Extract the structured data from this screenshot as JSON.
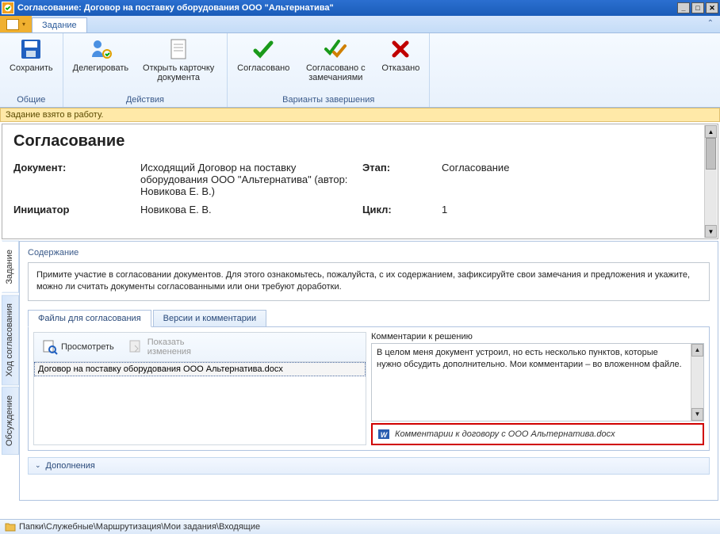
{
  "window": {
    "title": "Согласование: Договор на поставку оборудования ООО \"Альтернатива\""
  },
  "tabs": {
    "main": "Задание"
  },
  "ribbon": {
    "groups": [
      {
        "label": "Общие",
        "buttons": [
          {
            "label": "Сохранить"
          }
        ]
      },
      {
        "label": "Действия",
        "buttons": [
          {
            "label": "Делегировать"
          },
          {
            "label": "Открыть карточку документа"
          }
        ]
      },
      {
        "label": "Варианты завершения",
        "buttons": [
          {
            "label": "Согласовано"
          },
          {
            "label": "Согласовано с замечаниями"
          },
          {
            "label": "Отказано"
          }
        ]
      }
    ]
  },
  "status_message": "Задание взято в работу.",
  "info": {
    "heading": "Согласование",
    "doc_label": "Документ:",
    "doc_value": "Исходящий Договор на поставку оборудования ООО \"Альтернатива\" (автор: Новикова Е. В.)",
    "stage_label": "Этап:",
    "stage_value": "Согласование",
    "initiator_label": "Инициатор",
    "initiator_value": "Новикова Е. В.",
    "cycle_label": "Цикл:",
    "cycle_value": "1"
  },
  "side_tabs": {
    "task": "Задание",
    "progress": "Ход согласования",
    "discussion": "Обсуждение"
  },
  "content": {
    "section_label": "Содержание",
    "instructions": "Примите участие в согласовании документов. Для этого ознакомьтесь, пожалуйста, с их содержанием, зафиксируйте свои замечания и предложения и укажите, можно ли считать документы согласованными или они требуют доработки.",
    "inner_tabs": {
      "files": "Файлы для согласования",
      "versions": "Версии и комментарии"
    },
    "toolbar": {
      "view": "Просмотреть",
      "show_changes": "Показать изменения"
    },
    "file_list": [
      "Договор на поставку оборудования ООО Альтернатива.docx"
    ],
    "comments_label": "Комментарии к решению",
    "comments_text": "В целом меня документ устроил, но есть несколько пунктов, которые нужно обсудить дополнительно. Мои комментарии – во вложенном файле.",
    "attachment": "Комментарии к договору с ООО Альтернатива.doсx",
    "additions": "Дополнения"
  },
  "breadcrumb": "Папки\\Служебные\\Маршрутизация\\Мои задания\\Входящие"
}
